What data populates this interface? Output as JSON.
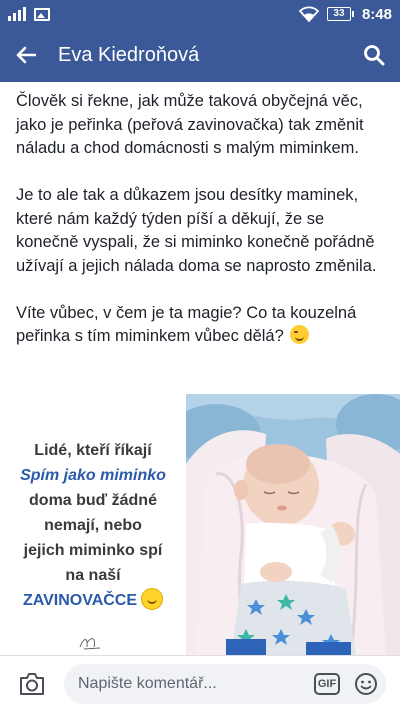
{
  "status_bar": {
    "time": "8:48",
    "battery": "33"
  },
  "header": {
    "title": "Eva Kiedroňová"
  },
  "post": {
    "paragraphs": [
      "Člověk si řekne, jak může taková obyčejná věc, jako je peřinka (peřová zavinovačka) tak změnit náladu a chod domácnosti s malým miminkem.",
      "Je to ale tak a důkazem jsou desítky maminek, které nám každý týden píší a děkují, že se konečně vyspali, že si miminko konečně pořádně užívají a jejich nálada doma se naprosto změnila.",
      "Víte vůbec, v čem je ta magie? Co ta kouzelná peřinka s tím miminkem vůbec dělá?"
    ]
  },
  "promo": {
    "line1": "Lidé, kteří říkají",
    "line2": "Spím jako miminko",
    "line3": "doma buď žádné",
    "line4": "nemají, nebo",
    "line5": "jejich miminko spí",
    "line6": "na naší",
    "line7": "ZAVINOVAČCE"
  },
  "comment_bar": {
    "placeholder": "Napište komentář...",
    "gif_label": "GIF"
  },
  "colors": {
    "brand": "#3b5998",
    "promo_blue": "#2a5aa8"
  },
  "icons": {
    "back": "arrow-left-icon",
    "search": "search-icon",
    "camera": "camera-icon",
    "emoji": "emoji-icon",
    "wifi": "wifi-icon"
  }
}
